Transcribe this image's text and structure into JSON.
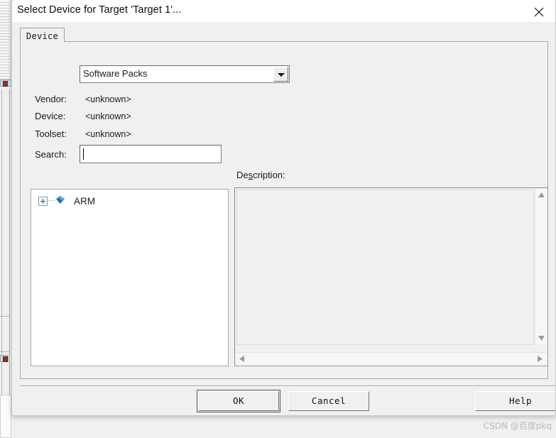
{
  "window": {
    "title": "Select Device for Target 'Target 1'...",
    "close_icon": "close-icon"
  },
  "tabs": [
    {
      "label": "Device",
      "selected": true
    }
  ],
  "combo": {
    "value": "Software Packs",
    "arrow_icon": "chevron-down-icon",
    "options": [
      "Software Packs"
    ]
  },
  "info_rows": [
    {
      "label": "Vendor:",
      "value": "<unknown>"
    },
    {
      "label": "Device:",
      "value": "<unknown>"
    },
    {
      "label": "Toolset:",
      "value": "<unknown>"
    }
  ],
  "search": {
    "label": "Search:",
    "value": "",
    "placeholder": ""
  },
  "description": {
    "label_prefix": "De",
    "label_accel": "s",
    "label_suffix": "cription:",
    "text": ""
  },
  "tree": {
    "nodes": [
      {
        "label": "ARM",
        "expander": "+",
        "icon": "pack-cube-icon",
        "expanded": false
      }
    ]
  },
  "scrollbars": {
    "vertical": {
      "up_icon": "triangle-up-icon",
      "down_icon": "triangle-down-icon"
    },
    "horizontal": {
      "left_icon": "triangle-left-icon",
      "right_icon": "triangle-right-icon"
    }
  },
  "buttons": {
    "ok": "OK",
    "cancel": "Cancel",
    "help": "Help"
  },
  "watermark": {
    "text": "CSDN @百度pkq"
  },
  "colors": {
    "dialog_bg": "#f0f0f0",
    "titlebar_bg": "#ffffff",
    "field_bg": "#ffffff",
    "text": "#1a1a1a",
    "border": "#a0a0a0",
    "tree_icon": "#2f7fd0"
  }
}
